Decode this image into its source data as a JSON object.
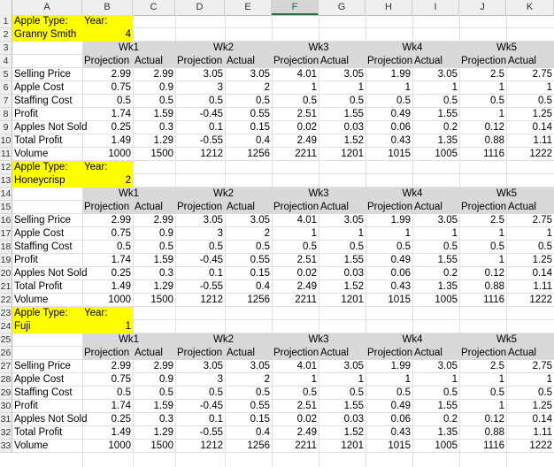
{
  "columns": [
    "A",
    "B",
    "C",
    "D",
    "E",
    "F",
    "G",
    "H",
    "I",
    "J",
    "K"
  ],
  "active_column": "F",
  "row_numbers": [
    "1",
    "2",
    "3",
    "4",
    "5",
    "6",
    "7",
    "8",
    "9",
    "10",
    "11",
    "12",
    "13",
    "14",
    "15",
    "16",
    "17",
    "18",
    "19",
    "20",
    "21",
    "22",
    "23",
    "24",
    "25",
    "26",
    "27",
    "28",
    "29",
    "30",
    "31",
    "32",
    "33"
  ],
  "labels": {
    "apple_type": "Apple Type:",
    "year": "Year:",
    "weeks": [
      "Wk1",
      "Wk2",
      "Wk3",
      "Wk4",
      "Wk5"
    ],
    "projection": "Projection",
    "actual": "Actual",
    "metrics": [
      "Selling Price",
      "Apple Cost",
      "Staffing Cost",
      "Profit",
      "Apples Not Sold",
      "Total Profit",
      "Volume"
    ]
  },
  "blocks": [
    {
      "apple": "Granny Smith",
      "year": "4",
      "rows": [
        [
          "2.99",
          "2.99",
          "3.05",
          "3.05",
          "4.01",
          "3.05",
          "1.99",
          "3.05",
          "2.5",
          "2.75"
        ],
        [
          "0.75",
          "0.9",
          "3",
          "2",
          "1",
          "1",
          "1",
          "1",
          "1",
          "1"
        ],
        [
          "0.5",
          "0.5",
          "0.5",
          "0.5",
          "0.5",
          "0.5",
          "0.5",
          "0.5",
          "0.5",
          "0.5"
        ],
        [
          "1.74",
          "1.59",
          "-0.45",
          "0.55",
          "2.51",
          "1.55",
          "0.49",
          "1.55",
          "1",
          "1.25"
        ],
        [
          "0.25",
          "0.3",
          "0.1",
          "0.15",
          "0.02",
          "0.03",
          "0.06",
          "0.2",
          "0.12",
          "0.14"
        ],
        [
          "1.49",
          "1.29",
          "-0.55",
          "0.4",
          "2.49",
          "1.52",
          "0.43",
          "1.35",
          "0.88",
          "1.11"
        ],
        [
          "1000",
          "1500",
          "1212",
          "1256",
          "2211",
          "1201",
          "1015",
          "1005",
          "1116",
          "1222"
        ]
      ]
    },
    {
      "apple": "Honeycrisp",
      "year": "2",
      "rows": [
        [
          "2.99",
          "2.99",
          "3.05",
          "3.05",
          "4.01",
          "3.05",
          "1.99",
          "3.05",
          "2.5",
          "2.75"
        ],
        [
          "0.75",
          "0.9",
          "3",
          "2",
          "1",
          "1",
          "1",
          "1",
          "1",
          "1"
        ],
        [
          "0.5",
          "0.5",
          "0.5",
          "0.5",
          "0.5",
          "0.5",
          "0.5",
          "0.5",
          "0.5",
          "0.5"
        ],
        [
          "1.74",
          "1.59",
          "-0.45",
          "0.55",
          "2.51",
          "1.55",
          "0.49",
          "1.55",
          "1",
          "1.25"
        ],
        [
          "0.25",
          "0.3",
          "0.1",
          "0.15",
          "0.02",
          "0.03",
          "0.06",
          "0.2",
          "0.12",
          "0.14"
        ],
        [
          "1.49",
          "1.29",
          "-0.55",
          "0.4",
          "2.49",
          "1.52",
          "0.43",
          "1.35",
          "0.88",
          "1.11"
        ],
        [
          "1000",
          "1500",
          "1212",
          "1256",
          "2211",
          "1201",
          "1015",
          "1005",
          "1116",
          "1222"
        ]
      ]
    },
    {
      "apple": "Fuji",
      "year": "1",
      "rows": [
        [
          "2.99",
          "2.99",
          "3.05",
          "3.05",
          "4.01",
          "3.05",
          "1.99",
          "3.05",
          "2.5",
          "2.75"
        ],
        [
          "0.75",
          "0.9",
          "3",
          "2",
          "1",
          "1",
          "1",
          "1",
          "1",
          "1"
        ],
        [
          "0.5",
          "0.5",
          "0.5",
          "0.5",
          "0.5",
          "0.5",
          "0.5",
          "0.5",
          "0.5",
          "0.5"
        ],
        [
          "1.74",
          "1.59",
          "-0.45",
          "0.55",
          "2.51",
          "1.55",
          "0.49",
          "1.55",
          "1",
          "1.25"
        ],
        [
          "0.25",
          "0.3",
          "0.1",
          "0.15",
          "0.02",
          "0.03",
          "0.06",
          "0.2",
          "0.12",
          "0.14"
        ],
        [
          "1.49",
          "1.29",
          "-0.55",
          "0.4",
          "2.49",
          "1.52",
          "0.43",
          "1.35",
          "0.88",
          "1.11"
        ],
        [
          "1000",
          "1500",
          "1212",
          "1256",
          "2211",
          "1201",
          "1015",
          "1005",
          "1116",
          "1222"
        ]
      ]
    }
  ]
}
